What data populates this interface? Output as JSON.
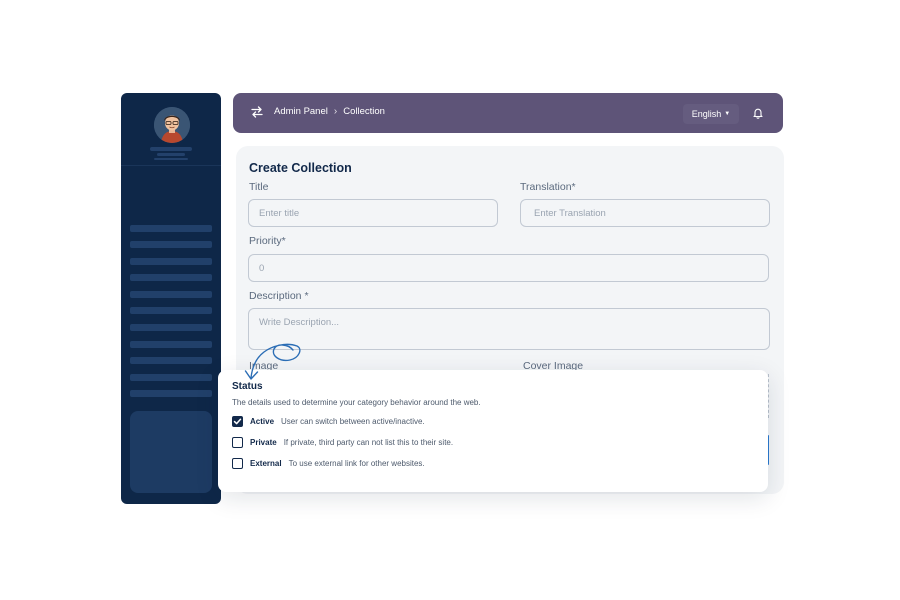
{
  "header": {
    "breadcrumb": [
      "Admin Panel",
      "Collection"
    ],
    "language": "English"
  },
  "form": {
    "title": "Create Collection",
    "fields": {
      "title": {
        "label": "Title",
        "placeholder": "Enter title"
      },
      "translation": {
        "label": "Translation*",
        "placeholder": "Enter Translation"
      },
      "priority": {
        "label": "Priority*",
        "placeholder": "0"
      },
      "description": {
        "label": "Description *",
        "placeholder": "Write Description..."
      },
      "image": {
        "label": "Image"
      },
      "cover_image": {
        "label": "Cover Image"
      }
    }
  },
  "status": {
    "title": "Status",
    "description": "The details used to determine your category behavior around the web.",
    "options": [
      {
        "name": "Active",
        "desc": "User can switch between active/inactive.",
        "checked": true
      },
      {
        "name": "Private",
        "desc": "If private, third party can not list this to their site.",
        "checked": false
      },
      {
        "name": "External",
        "desc": "To use external link for other websites.",
        "checked": false
      }
    ]
  },
  "colors": {
    "sidebar": "#0e2748",
    "header": "#5e5478",
    "accent": "#2b7bd0"
  }
}
